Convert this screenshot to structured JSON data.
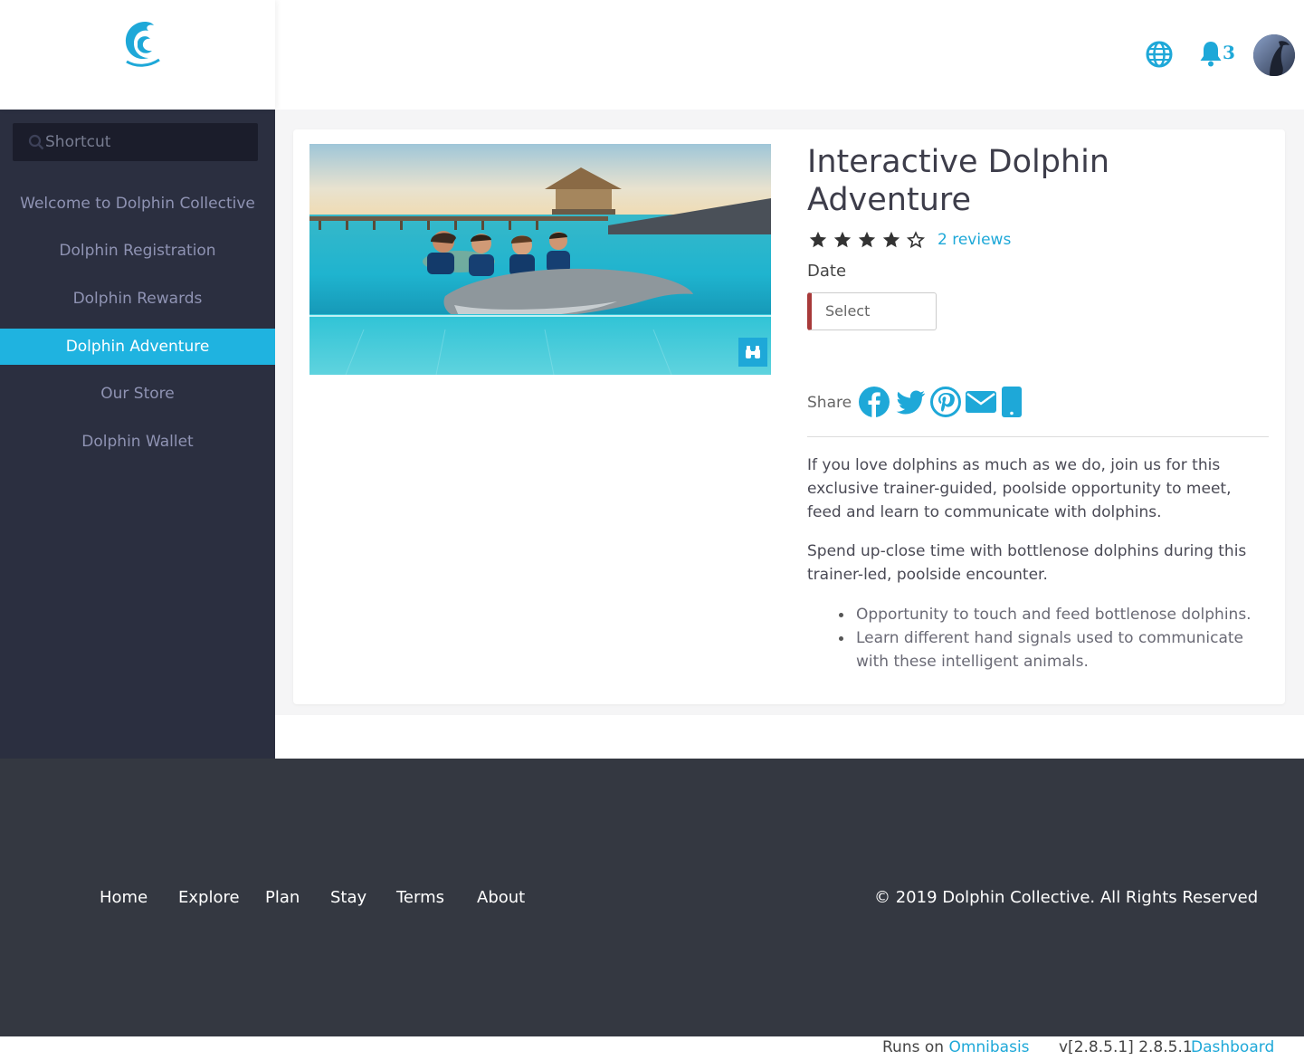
{
  "header": {
    "notification_count": "3",
    "accent_color": "#1ea8d8",
    "icons": [
      "dolphin-logo-icon",
      "globe-icon",
      "bell-icon",
      "avatar"
    ]
  },
  "sidebar": {
    "search_placeholder": "Shortcut",
    "items": [
      {
        "label": "Welcome to Dolphin Collective",
        "active": false
      },
      {
        "label": "Dolphin Registration",
        "active": false
      },
      {
        "label": "Dolphin Rewards",
        "active": false
      },
      {
        "label": "Dolphin Adventure",
        "active": true
      },
      {
        "label": "Our Store",
        "active": false
      },
      {
        "label": "Dolphin Wallet",
        "active": false
      }
    ]
  },
  "product": {
    "title": "Interactive Dolphin Adventure",
    "rating": 4,
    "rating_max": 5,
    "reviews_label": "2 reviews",
    "date_label": "Date",
    "date_select_value": "Select",
    "share_label": "Share",
    "share_icons": [
      "facebook-icon",
      "twitter-icon",
      "pinterest-icon",
      "email-icon",
      "mobile-icon"
    ],
    "description": [
      "If you love dolphins as much as we do, join us for this exclusive trainer-guided, poolside opportunity to meet, feed and learn to communicate with dolphins.",
      "Spend up-close time with bottlenose dolphins during this trainer-led, poolside encounter."
    ],
    "bullets": [
      "Opportunity to touch and feed bottlenose dolphins.",
      "Learn different hand signals used to communicate with these intelligent animals."
    ]
  },
  "footer": {
    "links": [
      "Home",
      "Explore",
      "Plan",
      "Stay",
      "Terms",
      "About"
    ],
    "copyright": "© 2019 Dolphin Collective. All Rights Reserved"
  },
  "bottombar": {
    "runs_on_prefix": "Runs on",
    "runs_on_link": "Omnibasis",
    "version": "v[2.8.5.1] 2.8.5.1",
    "dashboard_link": "Dashboard"
  }
}
